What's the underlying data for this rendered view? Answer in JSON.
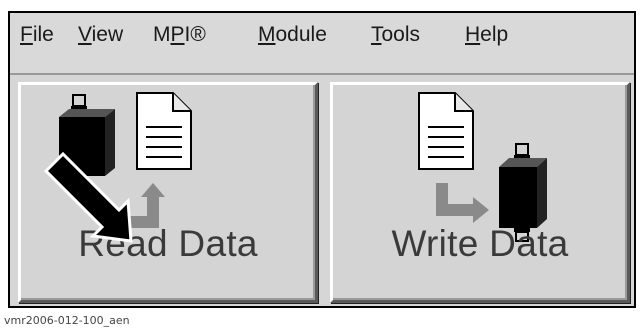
{
  "menu": {
    "items": [
      {
        "pre": "",
        "acc": "F",
        "post": "ile"
      },
      {
        "pre": "",
        "acc": "V",
        "post": "iew"
      },
      {
        "pre": "M",
        "acc": "P",
        "post": "I®"
      },
      {
        "pre": "",
        "acc": "M",
        "post": "odule"
      },
      {
        "pre": "",
        "acc": "T",
        "post": "ools"
      },
      {
        "pre": "",
        "acc": "H",
        "post": "elp"
      }
    ]
  },
  "buttons": {
    "read": {
      "label": "Read Data",
      "icons": [
        "module-icon",
        "document-icon",
        "arrow-up-icon"
      ]
    },
    "write": {
      "label": "Write Data",
      "icons": [
        "document-icon",
        "arrow-right-icon",
        "module-icon"
      ]
    }
  },
  "annotation": {
    "pointer_icon": "pointer-arrow-icon"
  },
  "caption": "vmr2006-012-100_aen"
}
